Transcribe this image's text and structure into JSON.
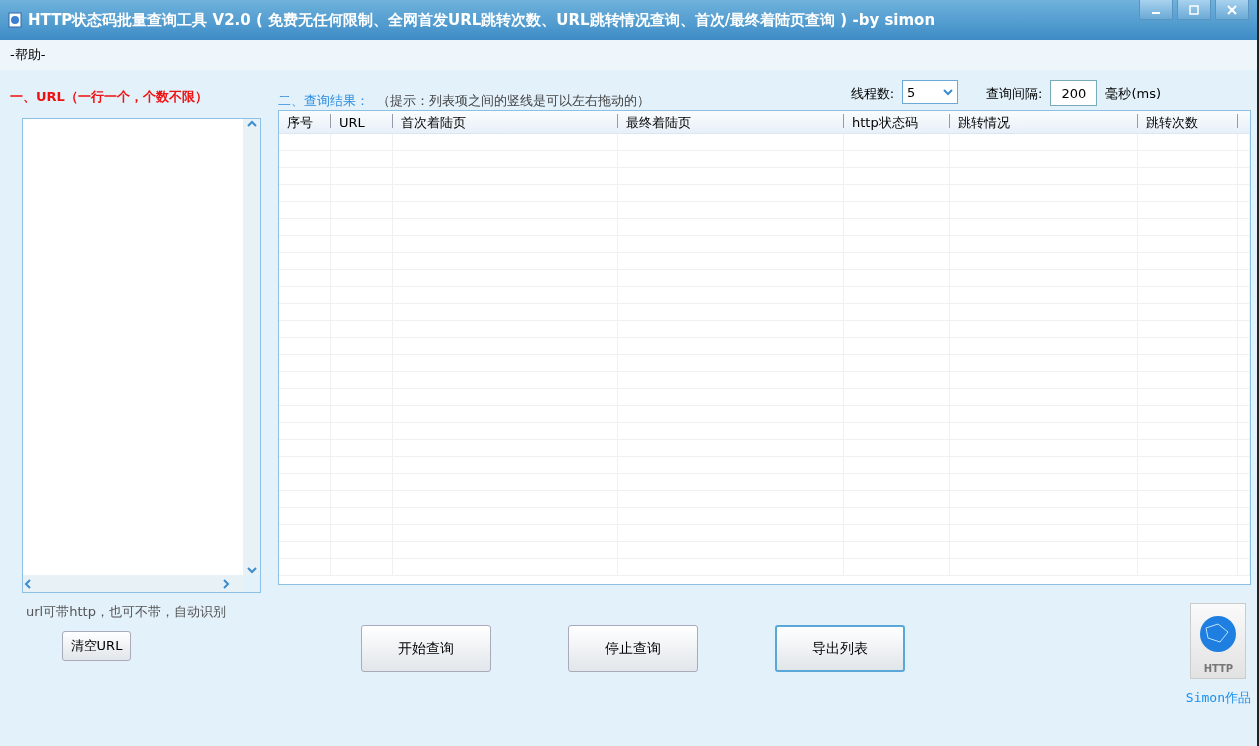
{
  "window": {
    "title": "HTTP状态码批量查询工具 V2.0 ( 免费无任何限制、全网首发URL跳转次数、URL跳转情况查询、首次/最终着陆页查询 ) -by simon"
  },
  "menu": [
    "-帮助-"
  ],
  "url_panel": {
    "heading": "一、URL（一行一个，个数不限）",
    "hint": "url可带http，也可不带，自动识别",
    "clear_button": "清空URL"
  },
  "results": {
    "heading": "二、查询结果：",
    "tip": "（提示：列表项之间的竖线是可以左右拖动的）"
  },
  "threads": {
    "label": "线程数:",
    "value": "5"
  },
  "interval": {
    "label": "查询间隔:",
    "value": "200",
    "unit": "毫秒(ms)"
  },
  "table": {
    "columns": [
      "序号",
      "URL",
      "首次着陆页",
      "最终着陆页",
      "http状态码",
      "跳转情况",
      "跳转次数"
    ]
  },
  "buttons": [
    {
      "label": "开始查询",
      "focused": false
    },
    {
      "label": "停止查询",
      "focused": false
    },
    {
      "label": "导出列表",
      "focused": true
    }
  ],
  "badge": {
    "icon_text": "HTTP",
    "caption": "Simon作品"
  }
}
